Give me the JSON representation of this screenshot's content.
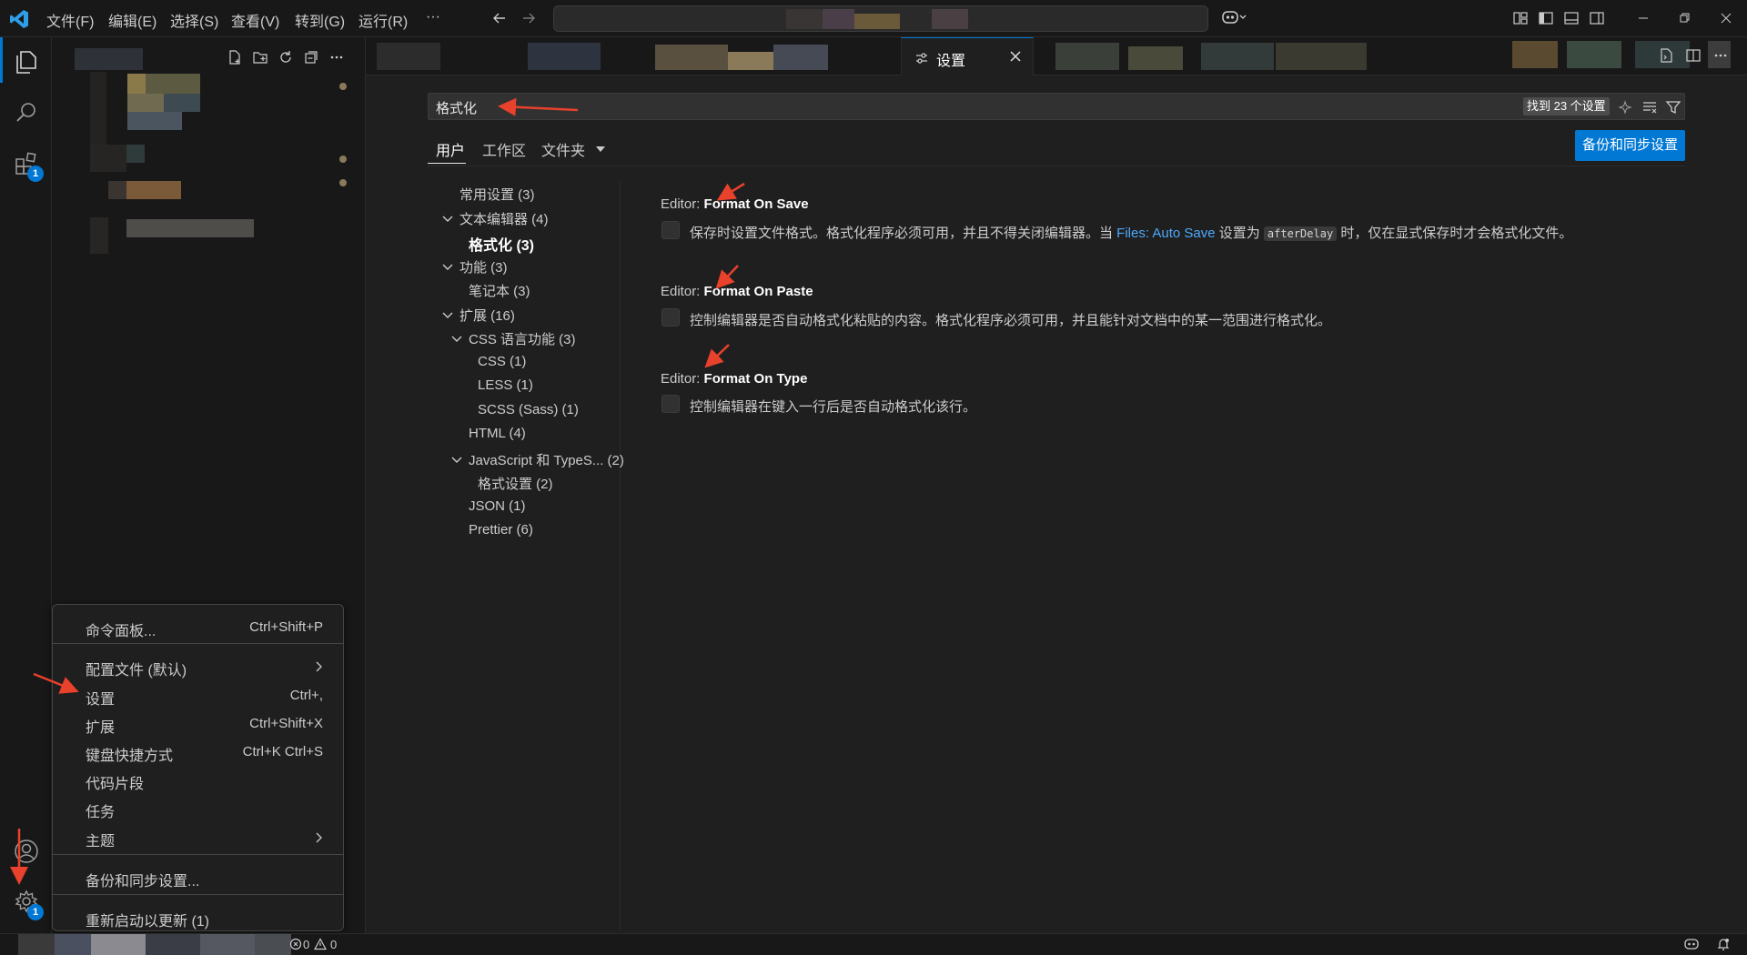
{
  "titlebar": {
    "menus": [
      "文件(F)",
      "编辑(E)",
      "选择(S)",
      "查看(V)",
      "转到(G)",
      "运行(R)",
      "···"
    ]
  },
  "activitybar": {
    "extensions_badge": "1",
    "manage_badge": "1"
  },
  "tabs": {
    "settings_label": "设置"
  },
  "settings": {
    "search_value": "格式化",
    "result_count": "找到 23 个设置",
    "scopes": [
      "用户",
      "工作区",
      "文件夹"
    ],
    "sync_button": "备份和同步设置",
    "toc": [
      {
        "label": "常用设置 (3)",
        "level": 1,
        "chevron": false
      },
      {
        "label": "文本编辑器 (4)",
        "level": 1,
        "chevron": true
      },
      {
        "label": "格式化 (3)",
        "level": 2,
        "chevron": false,
        "active": true
      },
      {
        "label": "功能 (3)",
        "level": 1,
        "chevron": true
      },
      {
        "label": "笔记本 (3)",
        "level": 2,
        "chevron": false
      },
      {
        "label": "扩展 (16)",
        "level": 1,
        "chevron": true
      },
      {
        "label": "CSS 语言功能 (3)",
        "level": 2,
        "chevron": true
      },
      {
        "label": "CSS (1)",
        "level": 3,
        "chevron": false
      },
      {
        "label": "LESS (1)",
        "level": 3,
        "chevron": false
      },
      {
        "label": "SCSS (Sass) (1)",
        "level": 3,
        "chevron": false
      },
      {
        "label": "HTML (4)",
        "level": 2,
        "chevron": false
      },
      {
        "label": "JavaScript 和 TypeS... (2)",
        "level": 2,
        "chevron": true
      },
      {
        "label": "格式设置 (2)",
        "level": 3,
        "chevron": false
      },
      {
        "label": "JSON (1)",
        "level": 2,
        "chevron": false
      },
      {
        "label": "Prettier (6)",
        "level": 2,
        "chevron": false
      }
    ],
    "items": [
      {
        "category": "Editor: ",
        "name": "Format On Save",
        "checked": false,
        "desc_before": "保存时设置文件格式。格式化程序必须可用，并且不得关闭编辑器。当 ",
        "desc_link": "Files: Auto Save",
        "desc_mid": " 设置为 ",
        "desc_code": "afterDelay",
        "desc_after": " 时，仅在显式保存时才会格式化文件。"
      },
      {
        "category": "Editor: ",
        "name": "Format On Paste",
        "checked": false,
        "desc_before": "控制编辑器是否自动格式化粘贴的内容。格式化程序必须可用，并且能针对文档中的某一范围进行格式化。"
      },
      {
        "category": "Editor: ",
        "name": "Format On Type",
        "checked": false,
        "desc_before": "控制编辑器在键入一行后是否自动格式化该行。"
      }
    ]
  },
  "context_menu": {
    "items": [
      {
        "label": "命令面板...",
        "key": "Ctrl+Shift+P",
        "submenu": false
      },
      {
        "label": "配置文件 (默认)",
        "key": "",
        "submenu": true
      },
      {
        "label": "设置",
        "key": "Ctrl+,",
        "submenu": false
      },
      {
        "label": "扩展",
        "key": "Ctrl+Shift+X",
        "submenu": false
      },
      {
        "label": "键盘快捷方式",
        "key": "Ctrl+K Ctrl+S",
        "submenu": false
      },
      {
        "label": "代码片段",
        "key": "",
        "submenu": false
      },
      {
        "label": "任务",
        "key": "",
        "submenu": false
      },
      {
        "label": "主题",
        "key": "",
        "submenu": true
      },
      {
        "label": "备份和同步设置...",
        "key": "",
        "submenu": false
      },
      {
        "label": "重新启动以更新 (1)",
        "key": "",
        "submenu": false
      }
    ]
  },
  "statusbar": {
    "errors": "0",
    "warnings": "0"
  },
  "colors": {
    "accent": "#0078d4",
    "link": "#4daafc",
    "annotation": "#e8412c"
  }
}
